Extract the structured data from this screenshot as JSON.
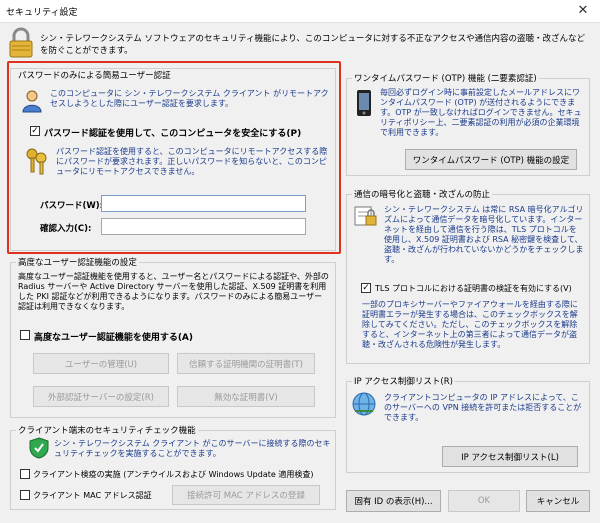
{
  "window": {
    "title": "セキュリティ設定",
    "close_glyph": "✕"
  },
  "header": {
    "text": "シン・テレワークシステム ソフトウェアのセキュリティ機能により、このコンピュータに対する不正なアクセスや通信内容の盗聴・改ざんなどを防ぐことができます。"
  },
  "password_group": {
    "label": "パスワードのみによる簡易ユーザー認証",
    "desc": "このコンピュータに シン・テレワークシステム クライアント がリモートアクセスしようとした際にユーザー認証を要求します。",
    "checkbox_label": "パスワード認証を使用して、このコンピュータを安全にする(P)",
    "checked": true,
    "check_glyph": "✓",
    "desc2": "パスワード認証を使用すると、このコンピュータにリモートアクセスする際にパスワードが要求されます。正しいパスワードを知らないと、このコンピュータにリモートアクセスできません。",
    "password_label": "パスワード(W):",
    "confirm_label": "確認入力(C):",
    "accent_color": "#e0301e"
  },
  "advanced_group": {
    "label": "高度なユーザー認証機能の設定",
    "desc": "高度なユーザー認証機能を使用すると、ユーザー名とパスワードによる認証や、外部の Radius サーバーや Active Directory サーバーを使用した認証、X.509 証明書を利用した PKI 認証などが利用できるようになります。パスワードのみによる簡易ユーザー認証は利用できなくなります。",
    "checkbox_label": "高度なユーザー認証機能を使用する(A)",
    "buttons": [
      "ユーザーの管理(U)",
      "信頼する証明機関の証明書(T)",
      "外部認証サーバーの設定(R)",
      "無効な証明書(V)"
    ]
  },
  "client_group": {
    "label": "クライアント端末のセキュリティチェック機能",
    "desc": "シン・テレワークシステム クライアント がこのサーバーに接続する際のセキュリティチェックを実施することができます。",
    "check1": "クライアント検疫の実施 (アンチウイルスおよび Windows Update 適用検査)",
    "check2": "クライアント MAC アドレス認証",
    "button": "接続許可 MAC アドレスの登録"
  },
  "otp_group": {
    "label": "ワンタイムパスワード (OTP) 機能 (二要素認証)",
    "desc": "毎回必ずログイン時に事前設定したメールアドレスにワンタイムパスワード (OTP) が送付されるようにできます。OTP が一致しなければログインできません。セキュリティポリシー上、二要素認証の利用が必須の企業環境で利用できます。",
    "button": "ワンタイムパスワード (OTP) 機能の設定"
  },
  "tls_group": {
    "label": "通信の暗号化と盗聴・改ざんの防止",
    "desc": "シン・テレワークシステム は常に RSA 暗号化アルゴリズムによって通信データを暗号化しています。インターネットを経由して通信を行う際は、TLS プロトコルを使用し、X.509 証明書および RSA 秘密鍵を検査して、盗聴・改ざんが行われていないかどうかをチェックします。",
    "checkbox_label": "TLS プロトコルにおける証明書の検証を有効にする(V)",
    "desc2": "一部のプロキシサーバーやファイアウォールを経由する際に証明書エラーが発生する場合は、このチェックボックスを解除してみてください。ただし、このチェックボックスを解除すると、インターネット上の第三者によって通信データが盗聴・改ざんされる危険性が発生します。"
  },
  "ip_group": {
    "label": "IP アクセス制御リスト(R)",
    "desc": "クライアントコンピュータの IP アドレスによって、このサーバーへの VPN 接続を許可または拒否することができます。",
    "button": "IP アクセス制御リスト(L)"
  },
  "footer": {
    "id_button": "固有 ID の表示(H)...",
    "ok_button": "OK",
    "cancel_button": "キャンセル"
  }
}
